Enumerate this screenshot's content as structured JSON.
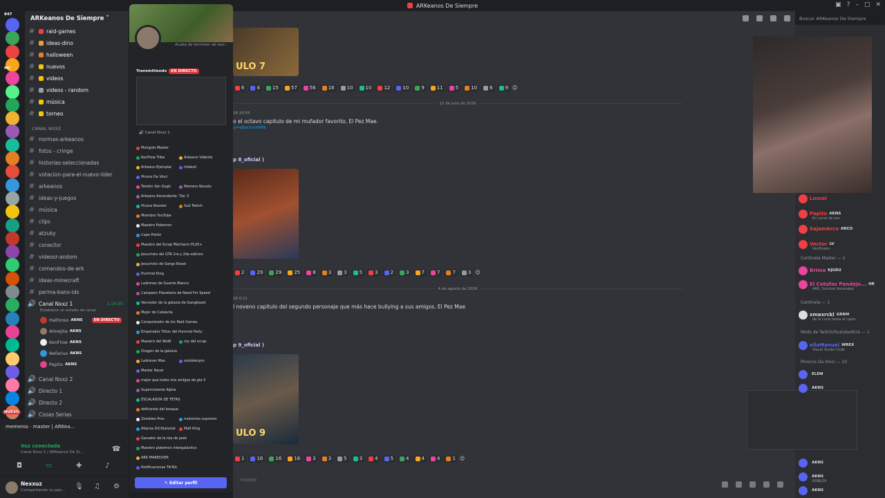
{
  "window": {
    "title": "ARKeanos De Siempre"
  },
  "rail": {
    "badges": [
      "847",
      "MC",
      "NUEVO"
    ]
  },
  "guild": {
    "name": "ARKeanos De Siempre"
  },
  "channels": [
    {
      "label": "raid-games",
      "color": "#f23f43"
    },
    {
      "label": "ideas-dino",
      "color": "#e6a23c"
    },
    {
      "label": "halloween",
      "color": "#e67e22"
    },
    {
      "label": "nuevos",
      "color": "#f1c40f"
    },
    {
      "label": "videos",
      "color": "#f1c40f"
    },
    {
      "label": "videos - random",
      "color": "#95a5a6"
    },
    {
      "label": "música",
      "color": "#f1c40f"
    },
    {
      "label": "torneo",
      "color": "#f1c40f"
    }
  ],
  "category2": "CANAL NXXZ",
  "channels2": [
    {
      "label": "normas-arkeanos"
    },
    {
      "label": "fotos - cringe"
    },
    {
      "label": "historias-seleccionadas"
    },
    {
      "label": "votacion-para-el-nuevo-lider"
    },
    {
      "label": "arkeanos"
    },
    {
      "label": "ideas-y-juegos"
    },
    {
      "label": "música"
    },
    {
      "label": "clips"
    },
    {
      "label": "atzuky"
    },
    {
      "label": "conector"
    },
    {
      "label": "videosr-andom"
    },
    {
      "label": "comandos-de-ark"
    },
    {
      "label": "ideas-minecraft"
    },
    {
      "label": "perma-bans-ids"
    }
  ],
  "voice": {
    "channel": "Canal Nxxz 1",
    "time": "1:24:50",
    "status": "Establece un estado de canal",
    "users": [
      {
        "name": "Halfonso",
        "tag": "AKNS",
        "live": "EN DIRECTO"
      },
      {
        "name": "Almejita",
        "tag": "AKNS"
      },
      {
        "name": "KenFlow",
        "tag": "AKNS"
      },
      {
        "name": "Nefarius",
        "tag": "AKNS"
      },
      {
        "name": "Papito",
        "tag": "AKNS"
      }
    ],
    "others": [
      "Canal Nxxz 2",
      "Directo 1",
      "Directo 2",
      "Cosas Serias"
    ]
  },
  "voicepanel": {
    "server": "memeros · master | ARKea...",
    "connected": "Voz conectada",
    "where": "Canal Nxxz 1 / ARKeanos De Si..."
  },
  "user": {
    "name": "Nexxuz",
    "status": "Compartiendo su pan..."
  },
  "profile": {
    "note": "Acabo de terminar de leer...",
    "streaming": "Transmitiendo",
    "live": "EN DIRECTO",
    "stream_channel": "Canal Nxxz 1",
    "edit": "Editar perfil",
    "roles": [
      [
        "Mongolo Master",
        ""
      ],
      [
        "KenFlow Tribe",
        "Arkeano Vidente"
      ],
      [
        "Arkeano Ejemplar",
        "Imbesil"
      ],
      [
        "Pinoce Da Vinci",
        ""
      ],
      [
        "Toretto Van Gogh",
        "Memero Novato"
      ],
      [
        "Arkeano Ascendente: Tier 3",
        ""
      ],
      [
        "Pinoce Booster",
        "Sub Twitch"
      ],
      [
        "Miembro YouTube",
        ""
      ],
      [
        "Maestro Pokemon",
        ""
      ],
      [
        "Cope Pistón",
        ""
      ],
      [
        "Maestro del Scrap Mechanic PLUS+",
        ""
      ],
      [
        "Jesucristo del GTA 1ra y 2da edicion",
        ""
      ],
      [
        "Jesucristo de Gangs Beast",
        ""
      ],
      [
        "Pummel King",
        ""
      ],
      [
        "Ladrones de Guante Blanco",
        ""
      ],
      [
        "Campeon Planetario de Need For Speed",
        ""
      ],
      [
        "Vencedor de la galaxia de Gangbeast",
        ""
      ],
      [
        "Mejor de Cataluña",
        ""
      ],
      [
        "Conquistador de los Raid Games",
        ""
      ],
      [
        "Emperador Triton del Pummel Party",
        ""
      ],
      [
        "Maestro del WoW",
        "rey del scrap"
      ],
      [
        "Dragon de la galaxia",
        ""
      ],
      [
        "Ladrones Max",
        "zombienpro"
      ],
      [
        "Master Racer",
        ""
      ],
      [
        "mejor que todos mis amigos de gta 5",
        ""
      ],
      [
        "Superviviente Alpha",
        ""
      ],
      [
        "ESCALADOR DE TETAS",
        ""
      ],
      [
        "deficiente del bosque",
        ""
      ],
      [
        "Zombies Pros",
        "motorista supremo"
      ],
      [
        "Alianza DiCKtatorial",
        "Mafi King"
      ],
      [
        "Ganador de la isla de peet",
        ""
      ],
      [
        "Maestro pokemon intergaláctico",
        ""
      ],
      [
        "ARK MAKEOVER",
        ""
      ],
      [
        "Notificaciones TikTok",
        ""
      ]
    ]
  },
  "toolbar": {
    "search": "Buscar ARKeanos De Siempre"
  },
  "messages": {
    "date1": "12 de julio de 2026",
    "date2": "4 de agosto de 2026",
    "time1": "26 20:55",
    "text1": "o el octavo capitulo de mi mufador favorito, El Pez Mae.",
    "link1": "/y=q6aCYvUtHF8",
    "chlink1": "p 8_oficial )",
    "time2": "26 6:21",
    "text2": "l noveno capitulo del segundo personaje que más hace bullying a sus amigos. El Pez Mae",
    "chlink2": "p 9_oficial )",
    "badge1": "ULO 7",
    "badge2": "ULO 9",
    "inputhint": "master"
  },
  "reactions1": [
    "6",
    "4",
    "15",
    "57",
    "56",
    "16",
    "10",
    "10",
    "12",
    "10",
    "9",
    "11",
    "5",
    "10",
    "6",
    "9"
  ],
  "reactions2": [
    "2",
    "29",
    "29",
    "25",
    "8",
    "3",
    "3",
    "5",
    "3",
    "2",
    "3",
    "7",
    "7",
    "7",
    "3"
  ],
  "reactions3": [
    "1",
    "16",
    "16",
    "16",
    "3",
    "3",
    "5",
    "3",
    "4",
    "5",
    "4",
    "4",
    "4",
    "1"
  ],
  "members": {
    "top": [
      {
        "name": "Lossel",
        "color": "#f23f43",
        "tag": ""
      },
      {
        "name": "Papito",
        "color": "#f23f43",
        "tag": "AKNS",
        "sub": "En canal de voz"
      },
      {
        "name": "SajamArco",
        "color": "#f23f43",
        "tag": "ARCO"
      },
      {
        "name": "Vector",
        "color": "#f23f43",
        "tag": "LV",
        "sub": "Verificado"
      }
    ],
    "group1": "Centinela Master — 2",
    "g1": [
      {
        "name": "Brima",
        "color": "#eb459e",
        "tag": "KJGRU"
      },
      {
        "name": "El Cotufas Pendejo...",
        "color": "#eb459e",
        "tag": "HR",
        "sub": "ARK: Survival Ascended"
      }
    ],
    "group2": "Centinela — 1",
    "g2": [
      {
        "name": "xmaxrckl",
        "color": "#dbdee1",
        "tag": "GRRM",
        "sub": "de la cuna hasta el cajón"
      }
    ],
    "group3": "Mods de Twitch/Youtube/Kick — 1",
    "g3": [
      {
        "name": "ellaManuel",
        "color": "#5865f2",
        "tag": "WREX",
        "sub": "Visual Studio Code"
      }
    ],
    "group4": "Pinocce Da Vinci — 10",
    "g4": [
      {
        "name": "",
        "color": "#5865f2",
        "tag": "ELDN"
      },
      {
        "name": "",
        "color": "#5865f2",
        "tag": "AKNS"
      }
    ],
    "bottom": [
      {
        "name": "",
        "color": "#5865f2",
        "tag": "AKNS"
      },
      {
        "name": "",
        "color": "#5865f2",
        "tag": "AKNS",
        "sub": "ROBLOX"
      },
      {
        "name": "",
        "color": "#5865f2",
        "tag": "AKNS"
      }
    ]
  }
}
